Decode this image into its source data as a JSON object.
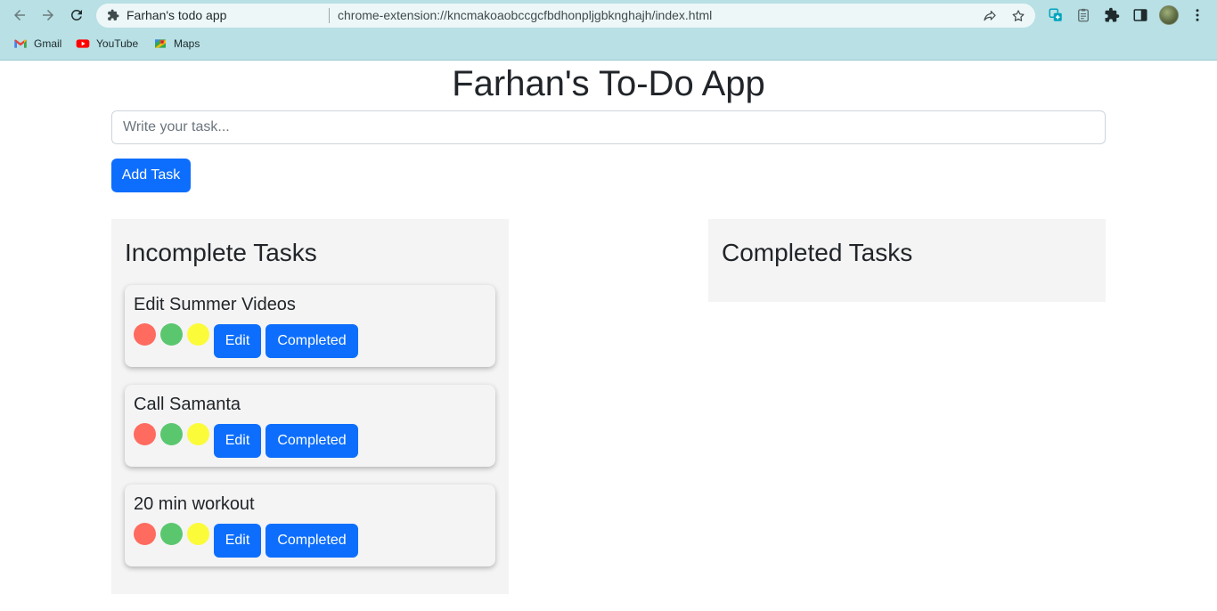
{
  "browser": {
    "tab_title": "Farhan's todo app",
    "url": "chrome-extension://kncmakoaobccgcfbdhonpljgbknghajh/index.html",
    "bookmarks": [
      {
        "label": "Gmail",
        "icon": "gmail-icon"
      },
      {
        "label": "YouTube",
        "icon": "youtube-icon"
      },
      {
        "label": "Maps",
        "icon": "maps-icon"
      }
    ],
    "colors": {
      "toolbar": "#b8e0e5",
      "omnibox": "#eef7f8"
    }
  },
  "app": {
    "title": "Farhan's To-Do App",
    "input_placeholder": "Write your task...",
    "input_value": "",
    "add_button_label": "Add Task",
    "incomplete_title": "Incomplete Tasks",
    "completed_title": "Completed Tasks",
    "tasks": [
      {
        "title": "Edit Summer Videos",
        "edit_label": "Edit",
        "completed_label": "Completed"
      },
      {
        "title": "Call Samanta",
        "edit_label": "Edit",
        "completed_label": "Completed"
      },
      {
        "title": "20 min workout",
        "edit_label": "Edit",
        "completed_label": "Completed"
      }
    ],
    "completed_tasks": [],
    "colors": {
      "primary": "#0d6efd",
      "panel_bg": "#f4f4f4",
      "priority_red": "#ff6b5f",
      "priority_green": "#5ac76f",
      "priority_yellow": "#fbfb3a"
    }
  }
}
